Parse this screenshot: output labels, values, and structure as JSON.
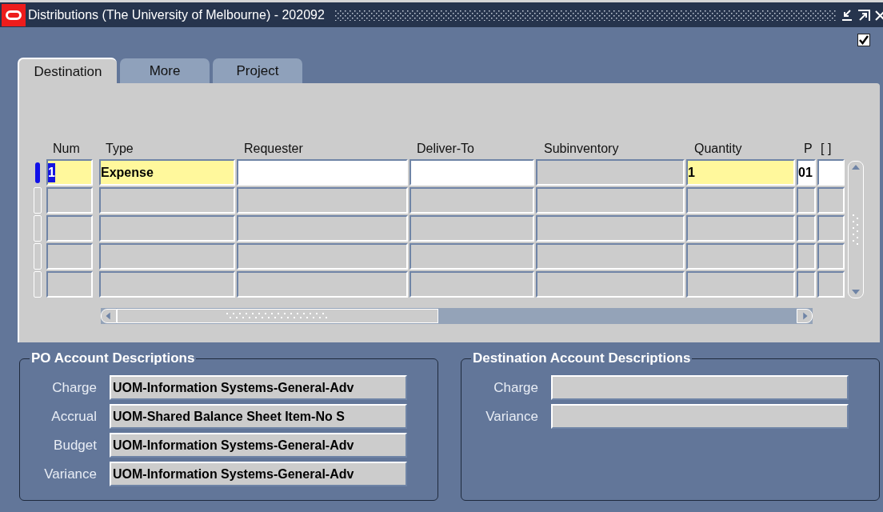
{
  "window": {
    "title": "Distributions (The University of Melbourne) - 202092"
  },
  "top_checkbox": {
    "checked": true
  },
  "tabs": [
    {
      "label": "Destination",
      "selected": true
    },
    {
      "label": "More",
      "selected": false
    },
    {
      "label": "Project",
      "selected": false
    }
  ],
  "table": {
    "columns": [
      "Num",
      "Type",
      "Requester",
      "Deliver-To",
      "Subinventory",
      "Quantity",
      "P",
      "[ ]"
    ],
    "rows": [
      {
        "selected": true,
        "cells": [
          {
            "kind": "required",
            "value": "1",
            "highlighted": true
          },
          {
            "kind": "required",
            "value": "Expense"
          },
          {
            "kind": "enabled"
          },
          {
            "kind": "enabled"
          },
          {
            "kind": "disabled"
          },
          {
            "kind": "required",
            "value": "1"
          },
          {
            "kind": "enabled",
            "value": "01"
          },
          {
            "kind": "enabled"
          }
        ]
      },
      {
        "selected": false,
        "cells": [
          {
            "kind": "disabled"
          },
          {
            "kind": "disabled"
          },
          {
            "kind": "disabled"
          },
          {
            "kind": "disabled"
          },
          {
            "kind": "disabled"
          },
          {
            "kind": "disabled"
          },
          {
            "kind": "disabled"
          },
          {
            "kind": "disabled"
          }
        ]
      },
      {
        "selected": false,
        "cells": [
          {
            "kind": "disabled"
          },
          {
            "kind": "disabled"
          },
          {
            "kind": "disabled"
          },
          {
            "kind": "disabled"
          },
          {
            "kind": "disabled"
          },
          {
            "kind": "disabled"
          },
          {
            "kind": "disabled"
          },
          {
            "kind": "disabled"
          }
        ]
      },
      {
        "selected": false,
        "cells": [
          {
            "kind": "disabled"
          },
          {
            "kind": "disabled"
          },
          {
            "kind": "disabled"
          },
          {
            "kind": "disabled"
          },
          {
            "kind": "disabled"
          },
          {
            "kind": "disabled"
          },
          {
            "kind": "disabled"
          },
          {
            "kind": "disabled"
          }
        ]
      },
      {
        "selected": false,
        "cells": [
          {
            "kind": "disabled"
          },
          {
            "kind": "disabled"
          },
          {
            "kind": "disabled"
          },
          {
            "kind": "disabled"
          },
          {
            "kind": "disabled"
          },
          {
            "kind": "disabled"
          },
          {
            "kind": "disabled"
          },
          {
            "kind": "disabled"
          }
        ]
      }
    ]
  },
  "po_account_descriptions": {
    "title": "PO Account Descriptions",
    "fields": [
      {
        "label": "Charge",
        "value": "UOM-Information Systems-General-Adv"
      },
      {
        "label": "Accrual",
        "value": "UOM-Shared Balance Sheet Item-No S"
      },
      {
        "label": "Budget",
        "value": "UOM-Information Systems-General-Adv"
      },
      {
        "label": "Variance",
        "value": "UOM-Information Systems-General-Adv"
      }
    ]
  },
  "destination_account_descriptions": {
    "title": "Destination Account Descriptions",
    "fields": [
      {
        "label": "Charge"
      },
      {
        "label": "Variance"
      }
    ]
  }
}
